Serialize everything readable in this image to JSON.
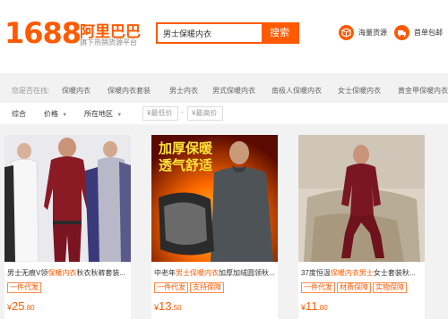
{
  "header": {
    "logo_num": "1688",
    "logo_cn": "阿里巴巴",
    "logo_sub": "旗下热销货源平台",
    "search_value": "男士保暖内衣",
    "search_button": "搜索",
    "links": [
      "海量货源",
      "首单包邮"
    ],
    "accent": "#ff5a00"
  },
  "breadcrumb": {
    "lead": "您是否在找:",
    "items": [
      "保暖内衣",
      "保暖内衣套装",
      "男士内衣",
      "男式保暖内衣",
      "南极人保暖内衣",
      "女士保暖内衣",
      "黄金甲保暖内衣"
    ]
  },
  "filters": {
    "items": [
      "综合",
      "价格",
      "所在地区"
    ],
    "price_min": "¥最低价",
    "price_max": "¥最高价",
    "dash": "-"
  },
  "products": [
    {
      "title_pre": "男士无痕V领",
      "title_hl": "保暖内衣",
      "title_post": "秋衣秋裤套装...",
      "tags": [
        "一件代发"
      ],
      "price_cur": "¥",
      "price_big": "25",
      "price_small": ".80"
    },
    {
      "title_pre": "中老年",
      "title_hl": "男士保暖内衣",
      "title_post": "加厚加绒圆领秋...",
      "tags": [
        "一件代发",
        "支持保障"
      ],
      "price_cur": "¥",
      "price_big": "13",
      "price_small": ".50",
      "overlay1": "加厚保暖",
      "overlay2": "透气舒适"
    },
    {
      "title_pre": "37度恒温",
      "title_hl": "保暖内衣男士",
      "title_post": "女士套装秋...",
      "tags": [
        "一件代发",
        "材质保障",
        "实物保障"
      ],
      "price_cur": "¥",
      "price_big": "11",
      "price_small": ".00"
    }
  ]
}
